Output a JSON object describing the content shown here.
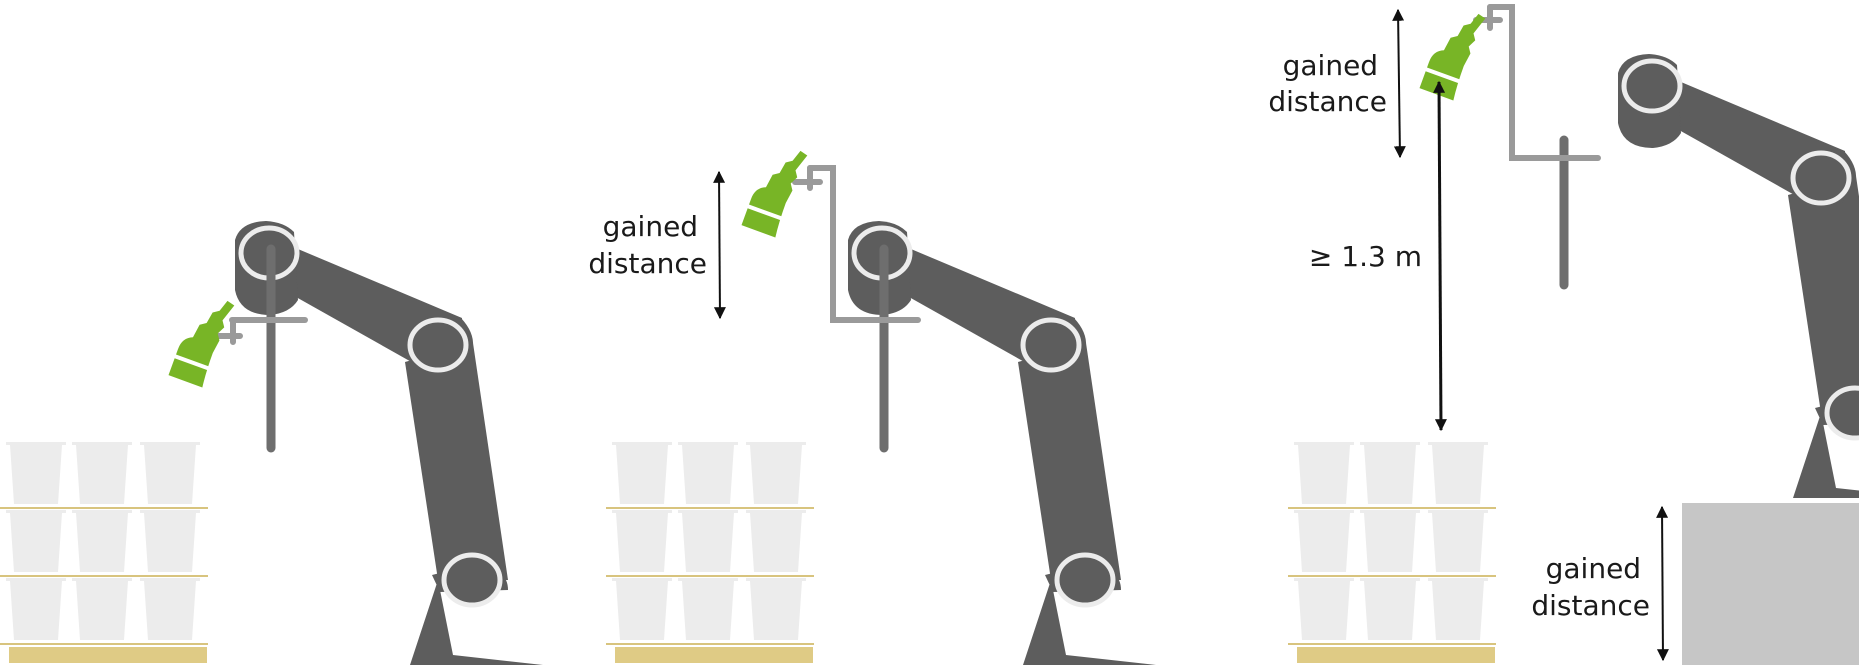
{
  "colors": {
    "robot": "#5d5d5d",
    "joint_ring": "#ececec",
    "mount": "#9a9a9a",
    "gripper": "#6e6e6e",
    "tool_green": "#78b526",
    "box": "#ececec",
    "layer_line": "#d8c47e",
    "pallet": "#dfcb85",
    "pedestal": "#c6c6c6",
    "arrow": "#111111",
    "background": "#ffffff"
  },
  "panels": [
    {
      "id": "baseline",
      "labels": []
    },
    {
      "id": "raised-tool",
      "labels": [
        {
          "key": "gained-distance",
          "lines": [
            "gained",
            "distance"
          ]
        }
      ]
    },
    {
      "id": "raised-tool-and-pedestal",
      "labels": [
        {
          "key": "gained-distance-tool",
          "lines": [
            "gained",
            "distance"
          ]
        },
        {
          "key": "reach-height",
          "lines": [
            "≥ 1.3 m"
          ]
        },
        {
          "key": "gained-distance-pedestal",
          "lines": [
            "gained",
            "distance"
          ]
        }
      ]
    }
  ],
  "pallet_grid": {
    "rows": 3,
    "cols": 3
  }
}
